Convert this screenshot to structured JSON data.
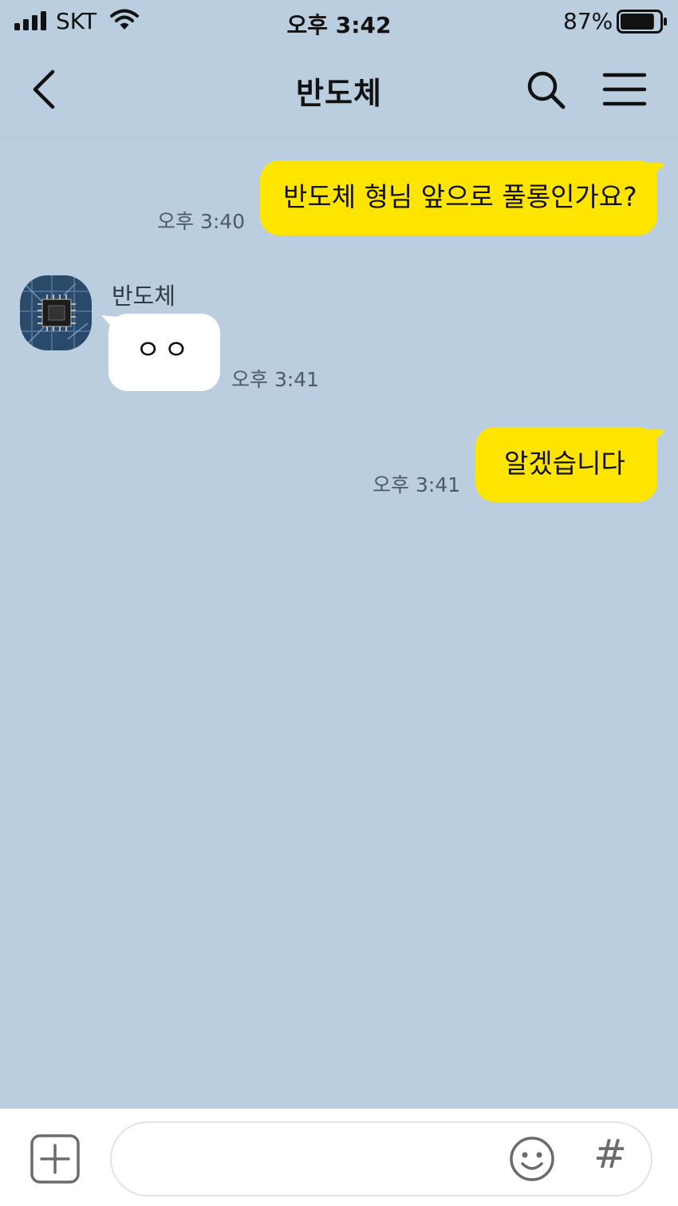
{
  "status_bar": {
    "carrier": "SKT",
    "time": "오후 3:42",
    "battery": "87%",
    "battery_level": 0.87,
    "icons": [
      "signal-icon",
      "wifi-icon",
      "battery-icon"
    ]
  },
  "header": {
    "title": "반도체",
    "icons": [
      "back-icon",
      "search-icon",
      "menu-icon"
    ]
  },
  "messages": [
    {
      "from": "me",
      "text": "반도체 형님 앞으로 풀롱인가요?",
      "time": "오후 3:40"
    },
    {
      "from": "other",
      "sender": "반도체",
      "text": "ㅇㅇ",
      "time": "오후 3:41"
    },
    {
      "from": "me",
      "text": "알겠습니다",
      "time": "오후 3:41"
    }
  ],
  "input_bar": {
    "icons": [
      "plus-icon",
      "emoji-icon",
      "hashtag-icon"
    ],
    "hash_label": "#"
  },
  "colors": {
    "background": "#bacee0",
    "my_bubble": "#fee500",
    "other_bubble": "#ffffff"
  }
}
